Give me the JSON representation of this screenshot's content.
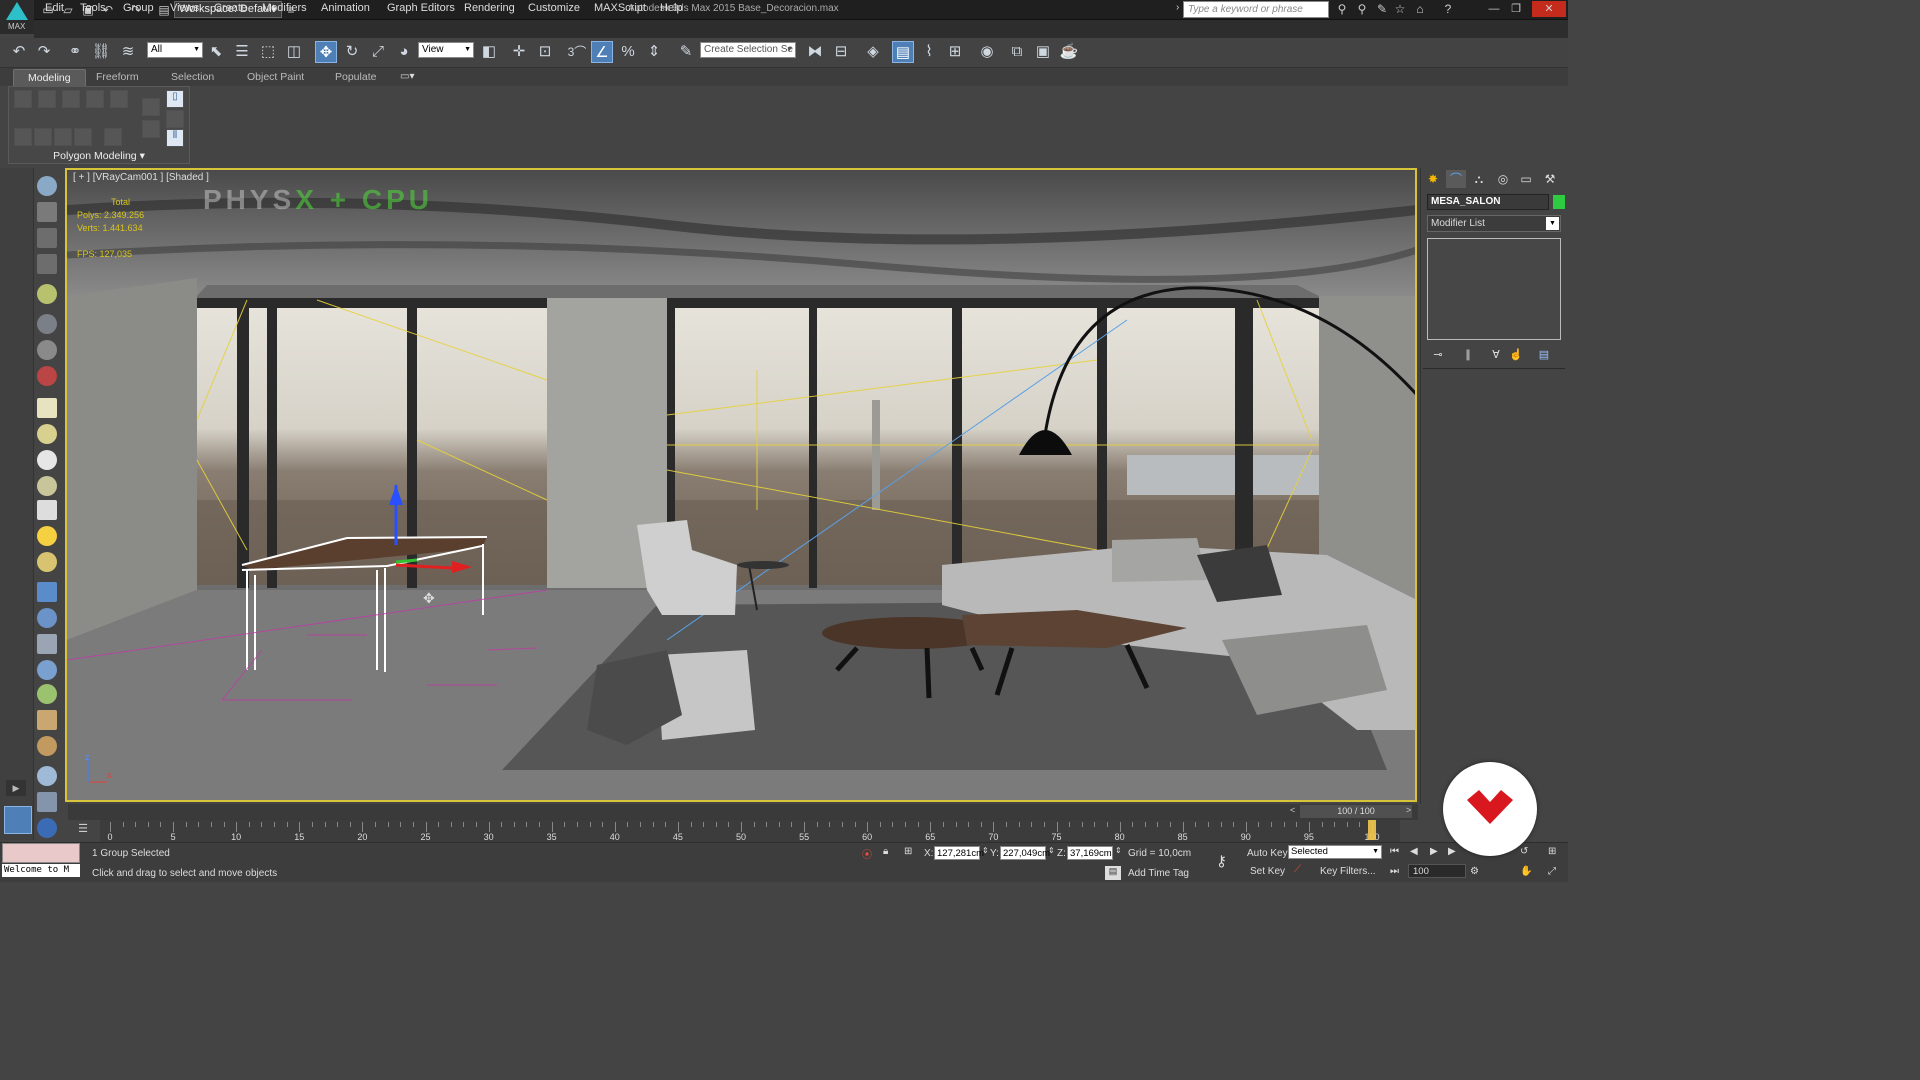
{
  "app": {
    "logo_label": "MAX",
    "title": "Autodesk 3ds Max 2015    Base_Decoracion.max",
    "workspace": "Workspace: Default",
    "search_placeholder": "Type a keyword or phrase"
  },
  "menu": [
    "Edit",
    "Tools",
    "Group",
    "Views",
    "Create",
    "Modifiers",
    "Animation",
    "Graph Editors",
    "Rendering",
    "Customize",
    "MAXScript",
    "Help"
  ],
  "toolbar": {
    "selection_filter": "All",
    "ref_coord": "View",
    "named_selection_placeholder": "Create Selection Se",
    "snap_label": "3"
  },
  "ribbon": {
    "tabs": [
      "Modeling",
      "Freeform",
      "Selection",
      "Object Paint",
      "Populate"
    ],
    "active_tab": "Modeling",
    "panel_label": "Polygon Modeling"
  },
  "viewport": {
    "label": "[ + ] [VRayCam001 ] [Shaded ]",
    "stats": {
      "header": "Total",
      "polys_label": "Polys:",
      "polys": "2.349.256",
      "verts_label": "Verts:",
      "verts": "1.441.634",
      "fps_label": "FPS:",
      "fps": "127,035"
    },
    "physx_a": "PHYS",
    "physx_b": "X",
    "physx_c": " + ",
    "physx_d": "CPU",
    "axis_z": "z",
    "axis_x": "x"
  },
  "command_panel": {
    "object_name": "MESA_SALON",
    "object_color": "#2ecc40",
    "modifier_list": "Modifier List"
  },
  "timeline": {
    "frame_display": "100 / 100",
    "ticks": [
      0,
      5,
      10,
      15,
      20,
      25,
      30,
      35,
      40,
      45,
      50,
      55,
      60,
      65,
      70,
      75,
      80,
      85,
      90,
      95,
      100
    ],
    "current_frame": 100
  },
  "status": {
    "welcome": "Welcome to M",
    "selection": "1 Group Selected",
    "prompt": "Click and drag to select and move objects",
    "x_label": "X:",
    "x": "127,281cm",
    "y_label": "Y:",
    "y": "227,049cm",
    "z_label": "Z:",
    "z": "37,169cm",
    "grid": "Grid = 10,0cm",
    "add_time_tag": "Add Time Tag",
    "auto_key": "Auto Key",
    "set_key": "Set Key",
    "key_mode": "Selected",
    "key_filters": "Key Filters...",
    "frame": "100"
  }
}
